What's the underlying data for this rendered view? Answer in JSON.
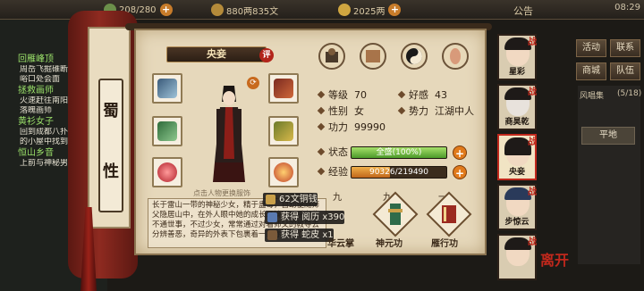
{
  "topbar": {
    "res1": "208/280",
    "res2": "880两835文",
    "res3": "2025两",
    "notice": "公告",
    "clock": "08:29"
  },
  "quests": [
    {
      "title": "回雁峰顶",
      "lines": [
        "周岳飞掘碓断",
        "峪口处会面"
      ]
    },
    {
      "title": "拯救画师",
      "lines": [
        "火速赶往南阳波",
        "落魄画师"
      ]
    },
    {
      "title": "黄衫女子",
      "lines": [
        "回到成都八扑门",
        "的小屋中找到李"
      ]
    },
    {
      "title": "恒山乡音",
      "lines": [
        "上前与神秘男"
      ]
    }
  ],
  "scroll_tag": [
    "蜀",
    "性"
  ],
  "character": {
    "name": "央妾",
    "ping_badge": "评",
    "change_label": "换装",
    "hint": "点击人物更换服饰",
    "level_label": "等级",
    "level": "70",
    "favor_label": "好感",
    "favor": "43",
    "gender_label": "性别",
    "gender": "女",
    "faction_label": "势力",
    "faction": "江湖中人",
    "power_label": "功力",
    "power": "99990",
    "state_label": "状态",
    "state": "全盛(100%)",
    "state_fraction": 1.0,
    "exp_label": "经验",
    "exp": "90326/219490",
    "exp_fraction": 0.41
  },
  "description": "长于雷山一带的神秘少女，精于蛊毒，自幼便随师父隐居山中，在外人眼中她的成长环境，似乎有些不通世事，不过少女，常常通过对着师父的教导去分辨善恶，奇异的外表下包裹着一颗赤诚的心...",
  "toasts": [
    {
      "text": "62文铜钱",
      "color": "#c9a04a"
    },
    {
      "text": "获得 阅历 x390",
      "color": "#5a7ab0"
    },
    {
      "text": "获得 蛇皮 x1",
      "color": "#7a5a3a"
    }
  ],
  "martial": [
    {
      "num": "九",
      "name": "华云掌"
    },
    {
      "num": "九",
      "name": "神元功"
    },
    {
      "num": "一",
      "name": "雁行功"
    }
  ],
  "right_menu": [
    "活动",
    "联系",
    "商城",
    "队伍"
  ],
  "right_list_label": "风唱集",
  "right_list_count": "(5/18)",
  "right_list_item": "平地",
  "portraits": [
    {
      "name": "星彩"
    },
    {
      "name": "商昊乾"
    },
    {
      "name": "央妾"
    },
    {
      "name": "步惊云"
    },
    {
      "name": ""
    }
  ],
  "seal_text": "离开"
}
